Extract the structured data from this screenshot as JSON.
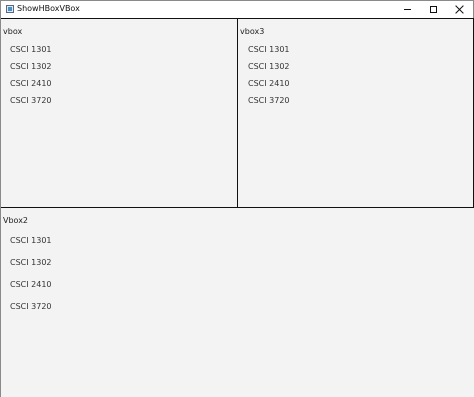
{
  "window": {
    "title": "ShowHBoxVBox",
    "icon": "app-window-icon"
  },
  "vbox": {
    "title": "vbox",
    "items": [
      "CSCI 1301",
      "CSCI 1302",
      "CSCI 2410",
      "CSCI 3720"
    ]
  },
  "vbox3": {
    "title": "vbox3",
    "items": [
      "CSCI 1301",
      "CSCI 1302",
      "CSCI 2410",
      "CSCI 3720"
    ]
  },
  "vbox2": {
    "title": "Vbox2",
    "items": [
      "CSCI 1301",
      "CSCI 1302",
      "CSCI 2410",
      "CSCI 3720"
    ]
  }
}
